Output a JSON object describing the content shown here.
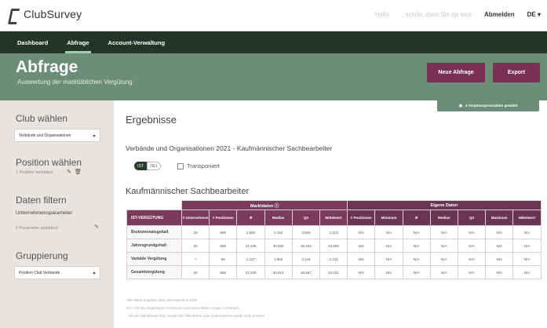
{
  "app": {
    "name": "ClubSurvey",
    "logo_icon": "club-survey-logo-icon"
  },
  "topbar": {
    "hello": "Hallo",
    "welcome": ", schön, dass Sie da sind",
    "logout": "Abmelden",
    "language": "DE ▾"
  },
  "nav": {
    "items": [
      {
        "label": "Dashboard",
        "active": false
      },
      {
        "label": "Abfrage",
        "active": true
      },
      {
        "label": "Account-Verwaltung",
        "active": false
      }
    ]
  },
  "hero": {
    "title": "Abfrage",
    "subtitle": "Auswertung der marktüblichen Vergütung",
    "new_query_label": "Neue Abfrage",
    "export_label": "Export"
  },
  "sidebar": {
    "club_heading": "Club wählen",
    "club_select": "Verbände und Organisationen",
    "position_heading": "Position wählen",
    "position_selected": "1 Position selektiert",
    "filter_heading": "Daten filtern",
    "company_params": "Unternehmensparameter",
    "params_selected": "0 Parameter selektiert",
    "group_heading": "Gruppierung",
    "group_select": "Position Club Verbände"
  },
  "main": {
    "vars_button": "4 Vergütungsvariablen gewählt",
    "results_heading": "Ergebnisse",
    "subtitle": "Verbände und Organisationen 2021 - Kaufmännischer Sachbearbeiter",
    "toggle_on": "IST",
    "toggle_off": "ZIEL",
    "transpose_label": "Transponiert",
    "table_title": "Kaufmännischer Sachbearbeiter"
  },
  "table": {
    "group_market": "Marktdaten  ⓘ",
    "group_own": "Eigene Daten",
    "row_header": "IST-VERGÜTUNG",
    "market_columns": [
      "# Unternehmen",
      "# Positionen",
      "Ø",
      "Median",
      "Q3",
      "Mittelwert"
    ],
    "own_columns": [
      "# Positionen",
      "Minimum",
      "Ø",
      "Median",
      "Q3",
      "Maximum",
      "Mittelwert"
    ],
    "rows": [
      {
        "label": "Bruttomonatsgehalt",
        "market": [
          "29",
          "680",
          "2.886",
          "3.154",
          "3.569",
          "3.313"
        ],
        "own": [
          "N/A",
          "N/A",
          "N/A",
          "N/A",
          "N/A",
          "N/A",
          "N/A"
        ]
      },
      {
        "label": "Jahresgrundgehalt",
        "market": [
          "29",
          "680",
          "37.230",
          "40.500",
          "45.434",
          "42.503"
        ],
        "own": [
          "N/A",
          "N/A",
          "N/A",
          "N/A",
          "N/A",
          "N/A",
          "N/A"
        ]
      },
      {
        "label": "Variable Vergütung",
        "market": [
          "7",
          "56",
          "1.127",
          "1.960",
          "3.125",
          "2.131"
        ],
        "own": [
          "N/A",
          "N/A",
          "N/A",
          "N/A",
          "N/A",
          "N/A",
          "N/A"
        ]
      },
      {
        "label": "Gesamtvergütung",
        "market": [
          "26",
          "680",
          "37.230",
          "40.914",
          "46.567",
          "43.021"
        ],
        "own": [
          "N/A",
          "N/A",
          "N/A",
          "N/A",
          "N/A",
          "N/A",
          "N/A"
        ]
      }
    ]
  },
  "footnotes": [
    "Alle Werte angaben sind Jahreswerte in EUR",
    "N/A: Für die angezeigten Parameter sind keine Daten vorgen vorhanden",
    "- Die ein Marktbreite bzw. Anzahl der Teilnehmer oder Unternehmen wurde nicht erreicht"
  ],
  "colors": {
    "nav_bg": "#23352a",
    "hero_bg": "#6c8d78",
    "accent_plum": "#7a2f54",
    "sidebar_bg": "#e9e4e0"
  }
}
